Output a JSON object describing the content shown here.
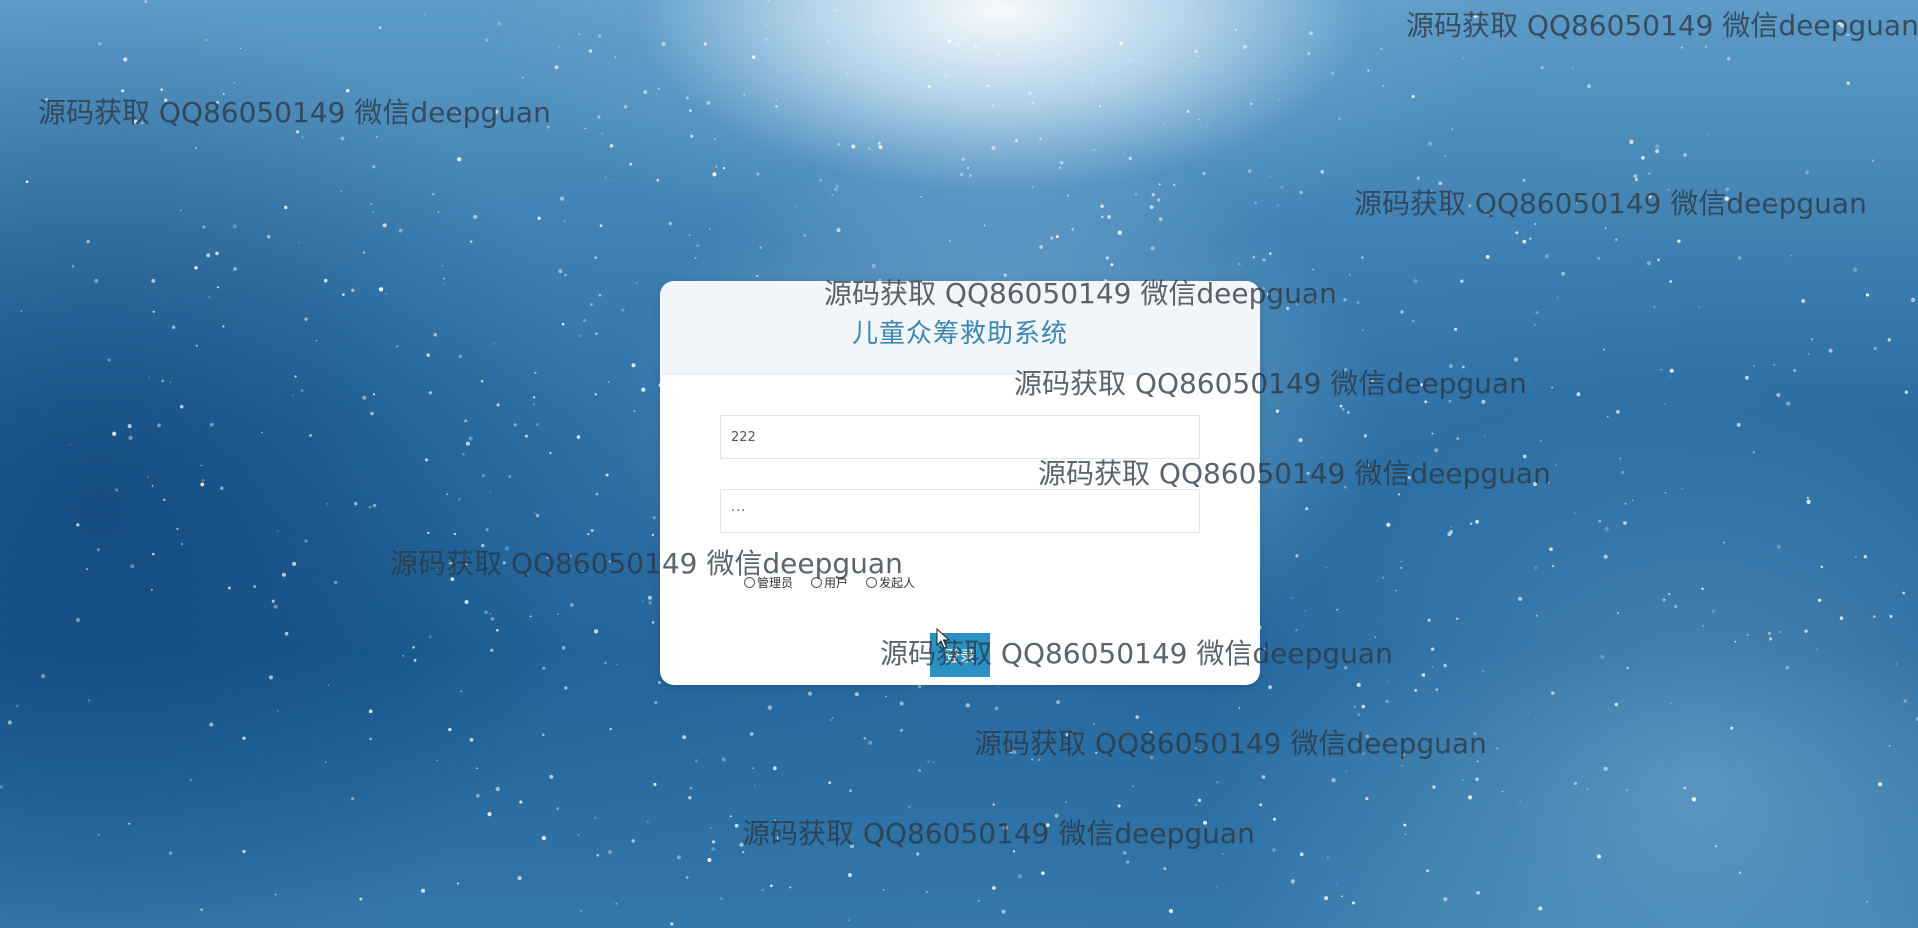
{
  "app": {
    "title": "儿童众筹救助系统"
  },
  "login": {
    "username_value": "222",
    "password_value": "···",
    "roles": [
      {
        "label": "管理员",
        "selected": false
      },
      {
        "label": "用户",
        "selected": false
      },
      {
        "label": "发起人",
        "selected": false
      }
    ],
    "submit_label": "登录"
  },
  "watermark": {
    "text": "源码获取 QQ86050149 微信deepguan"
  },
  "colors": {
    "title": "#3a86b4",
    "button": "#2b91c4",
    "card_header": "#f3f6f9"
  }
}
